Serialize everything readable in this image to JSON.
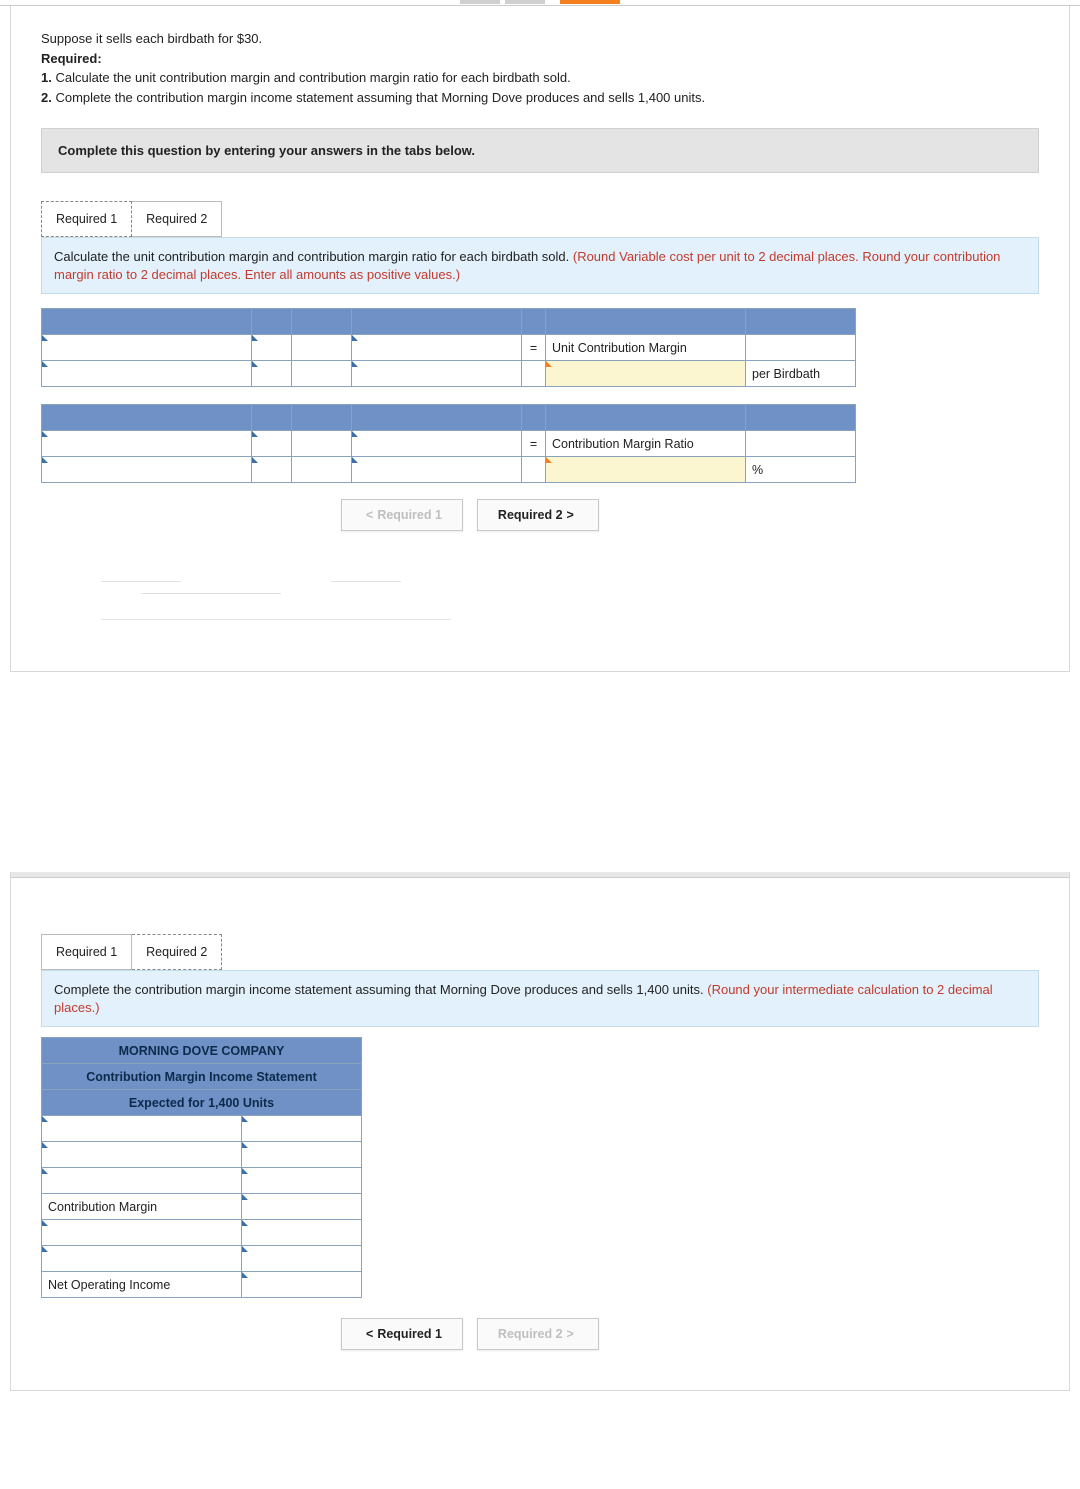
{
  "intro": {
    "line1": "Suppose it sells each birdbath for $30.",
    "req_label": "Required:",
    "req1_num": "1.",
    "req1": " Calculate the unit contribution margin and contribution margin ratio for each birdbath sold.",
    "req2_num": "2.",
    "req2": " Complete the contribution margin income statement assuming that Morning Dove produces and sells 1,400 units."
  },
  "banner": "Complete this question by entering your answers in the tabs below.",
  "tabs1": {
    "t1": "Required 1",
    "t2": "Required 2"
  },
  "instruction1": {
    "black": "Calculate the unit contribution margin and contribution margin ratio for each birdbath sold. ",
    "red": "(Round Variable cost per unit to 2 decimal places. Round your contribution margin ratio to 2 decimal places. Enter all amounts as positive values.)"
  },
  "table1": {
    "eq": "=",
    "ucm": "Unit Contribution Margin",
    "per": "per Birdbath",
    "cmr": "Contribution Margin Ratio",
    "pct": "%"
  },
  "nav1": {
    "prev": "Required 1",
    "next": "Required 2"
  },
  "tabs2": {
    "t1": "Required 1",
    "t2": "Required 2"
  },
  "instruction2": {
    "black": "Complete the contribution margin income statement assuming that Morning Dove produces and sells 1,400 units. ",
    "red": "(Round your intermediate calculation to 2 decimal places.)"
  },
  "table2": {
    "h1": "MORNING DOVE COMPANY",
    "h2": "Contribution Margin Income Statement",
    "h3": "Expected for 1,400 Units",
    "cm": "Contribution Margin",
    "noi": "Net Operating Income"
  },
  "nav2": {
    "prev": "Required 1",
    "next": "Required 2"
  }
}
